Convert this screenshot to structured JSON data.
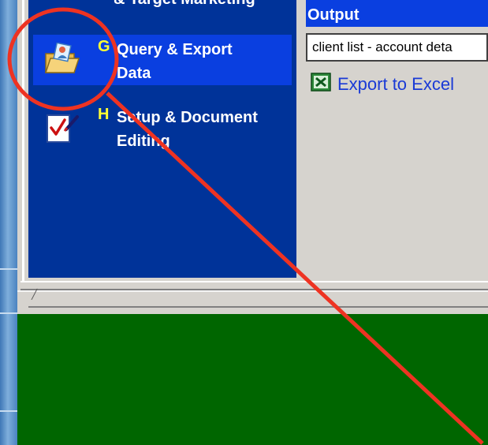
{
  "nav": {
    "prev_label": "& Target Marketing",
    "items": [
      {
        "letter": "G",
        "label": "Query & Export\nData",
        "icon": "folder-person-icon",
        "selected": true
      },
      {
        "letter": "H",
        "label": "Setup & Document\nEditing",
        "icon": "checklist-pen-icon",
        "selected": false
      }
    ]
  },
  "panel": {
    "header": "Output",
    "selected_output": "client list - account deta",
    "export_link": "Export to Excel",
    "export_icon": "excel-icon"
  },
  "colors": {
    "nav_bg": "#003399",
    "selected_bg": "#0a3fe0",
    "letter": "#ffff33",
    "link": "#1a3ad6",
    "bottom_bg": "#006600",
    "annotation": "#ee3322"
  }
}
